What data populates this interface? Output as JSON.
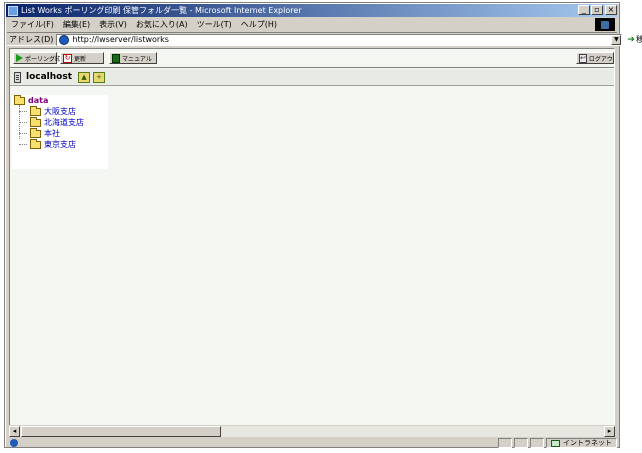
{
  "window": {
    "title": "List Works ポーリング印刷 保管フォルダ一覧 - Microsoft Internet Explorer",
    "buttons": {
      "minimize": "_",
      "maximize": "▫",
      "close": "×"
    }
  },
  "menu": [
    "ファイル(F)",
    "編集(E)",
    "表示(V)",
    "お気に入り(A)",
    "ツール(T)",
    "ヘルプ(H)"
  ],
  "address": {
    "label": "アドレス(D)",
    "url": "http://lwserver/listworks",
    "go_label": "移動"
  },
  "toolbar": {
    "polling_label": "ポーリング印刷",
    "refresh_label": "更新",
    "manual_label": "マニュアル",
    "logout_label": "ログアウト"
  },
  "host": {
    "name": "localhost"
  },
  "tree": {
    "root": "data",
    "items": [
      "大阪支店",
      "北海道支店",
      "本社",
      "東京支店"
    ]
  },
  "status": {
    "zone": "イントラネット"
  },
  "colors": {
    "titlebar_start": "#0a246a",
    "titlebar_end": "#a6caf0",
    "root_label": "#800080",
    "item_link": "#0000c0",
    "content_bg": "#f4f6f2"
  },
  "icons": {
    "polling": "play-icon",
    "refresh": "refresh-icon",
    "manual": "book-icon",
    "logout": "logout-icon",
    "server": "server-icon",
    "folder": "folder-icon"
  }
}
